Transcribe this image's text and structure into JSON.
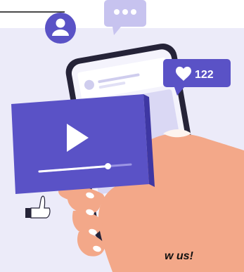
{
  "like_badge": {
    "count": "122",
    "icon": "heart-icon"
  },
  "footer": {
    "text": "w us!"
  },
  "icons": {
    "profile": "user-icon",
    "chat": "chat-bubble-icon",
    "play": "play-icon",
    "thumbs_up": "thumbs-up-icon"
  },
  "video_progress": 0.75,
  "colors": {
    "accent": "#5a52c6",
    "panel": "#ecebf9",
    "chat_bubble": "#c7c3ef",
    "phone": "#252338",
    "skin": "#f3a889"
  }
}
